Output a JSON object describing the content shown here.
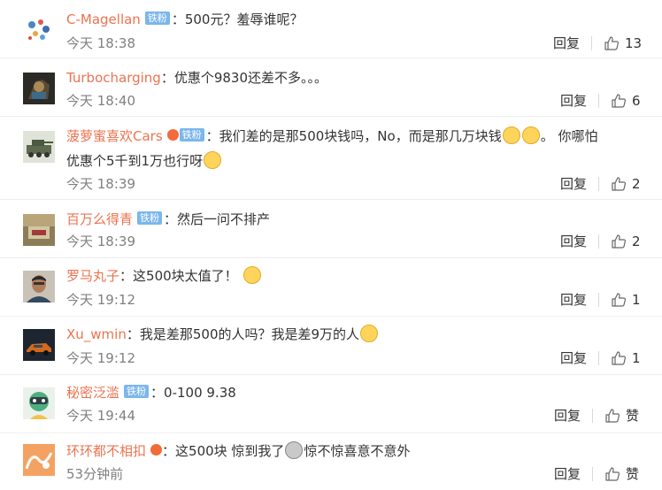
{
  "comments": [
    {
      "username": "C-Magellan",
      "badge": "铁粉",
      "separator": "：",
      "text": "500元？羞辱谁呢？",
      "time": "今天 18:38",
      "reply_label": "回复",
      "likes": "13"
    },
    {
      "username": "Turbocharging",
      "separator": "：",
      "text": "优惠个9830还差不多。。。",
      "time": "今天 18:40",
      "reply_label": "回复",
      "likes": "6"
    },
    {
      "username": "菠萝蜜喜欢Cars",
      "badge": "铁粉",
      "separator": "：",
      "text": "我们差的是那500块钱吗，No，而是那几万块钱",
      "text_after_emoji": "。 你哪怕",
      "text_line2": "优惠个5千到1万也行呀",
      "time": "今天 18:39",
      "reply_label": "回复",
      "likes": "2"
    },
    {
      "username": "百万么得青",
      "badge": "铁粉",
      "separator": "：",
      "text": "然后一问不排产",
      "time": "今天 18:39",
      "reply_label": "回复",
      "likes": "2"
    },
    {
      "username": "罗马丸子",
      "separator": "：",
      "text": "这500块太值了！",
      "time": "今天 19:12",
      "reply_label": "回复",
      "likes": "1"
    },
    {
      "username": "Xu_wmin",
      "separator": "：",
      "text": "我是差那500的人吗？我是差9万的人",
      "time": "今天 19:12",
      "reply_label": "回复",
      "likes": "1"
    },
    {
      "username": "秘密泛滥",
      "badge": "铁粉",
      "separator": "：",
      "text": "0-100 9.38",
      "time": "今天 19:44",
      "reply_label": "回复",
      "likes": "赞"
    },
    {
      "username": "环环都不相扣",
      "separator": "：",
      "text": "这500块 惊到我了",
      "text_after_emoji": "惊不惊喜意不意外",
      "time": "53分钟前",
      "reply_label": "回复",
      "likes": "赞"
    }
  ],
  "colors": {
    "username": "#eb7350",
    "badge": "#7bb6ec",
    "meta": "#808080"
  }
}
